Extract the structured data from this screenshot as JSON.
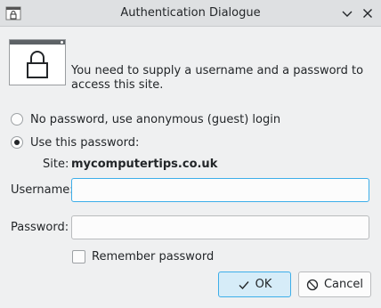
{
  "window": {
    "title": "Authentication Dialogue"
  },
  "dialog": {
    "message": "You need to supply a username and a password to access this site.",
    "options": {
      "anonymous_label": "No password, use anonymous (guest) login",
      "password_label": "Use this password:",
      "selected": "password"
    },
    "site": {
      "label": "Site:",
      "value": "mycomputertips.co.uk"
    },
    "username": {
      "label": "Username:",
      "value": ""
    },
    "password": {
      "label": "Password:",
      "value": ""
    },
    "remember": {
      "label": "Remember password",
      "checked": false
    },
    "buttons": {
      "ok_label": "OK",
      "cancel_label": "Cancel"
    }
  },
  "icons": {
    "app": "lock-window-icon",
    "minimize": "chevron-down-icon",
    "close": "close-icon",
    "ok": "checkmark-icon",
    "cancel": "cancel-icon"
  },
  "colors": {
    "accent": "#3daee9",
    "background": "#eff0f1"
  }
}
